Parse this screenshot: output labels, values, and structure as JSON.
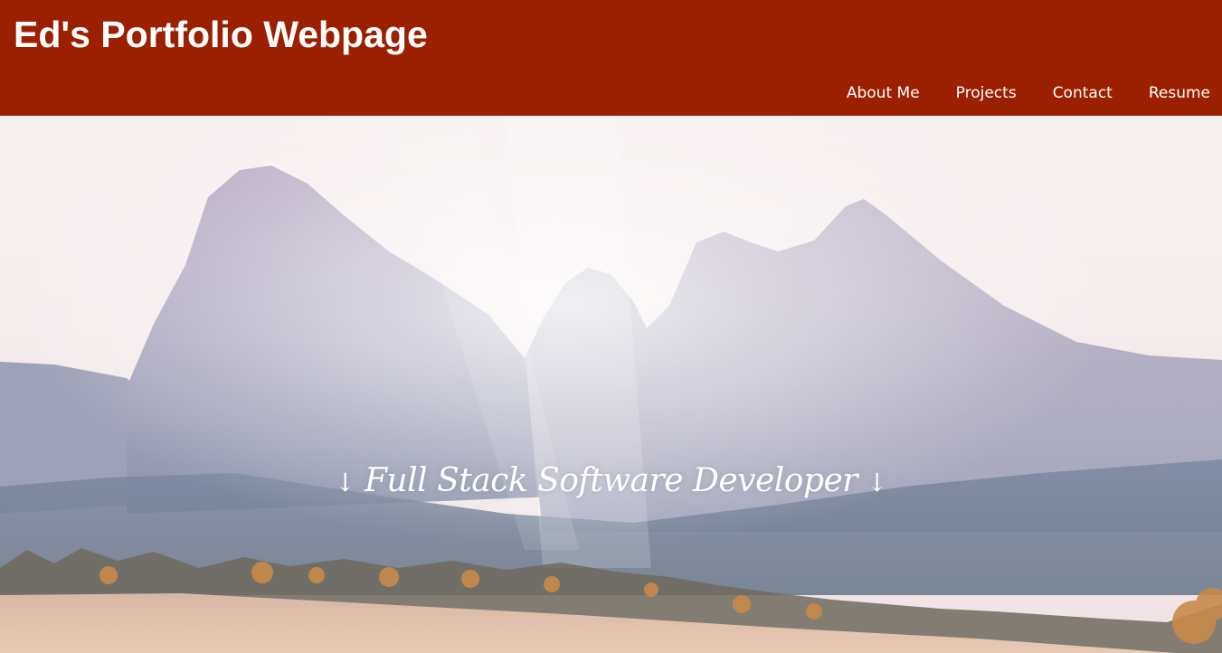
{
  "header": {
    "title": "Ed's Portfolio Webpage",
    "background_color": "#9b2000"
  },
  "nav": {
    "items": [
      {
        "label": "About Me"
      },
      {
        "label": "Projects"
      },
      {
        "label": "Contact"
      },
      {
        "label": "Resume"
      }
    ]
  },
  "hero": {
    "image": "mountain-landscape-image",
    "tagline": "Full Stack Software Developer",
    "arrow_left": "↓",
    "arrow_right": "↓"
  }
}
